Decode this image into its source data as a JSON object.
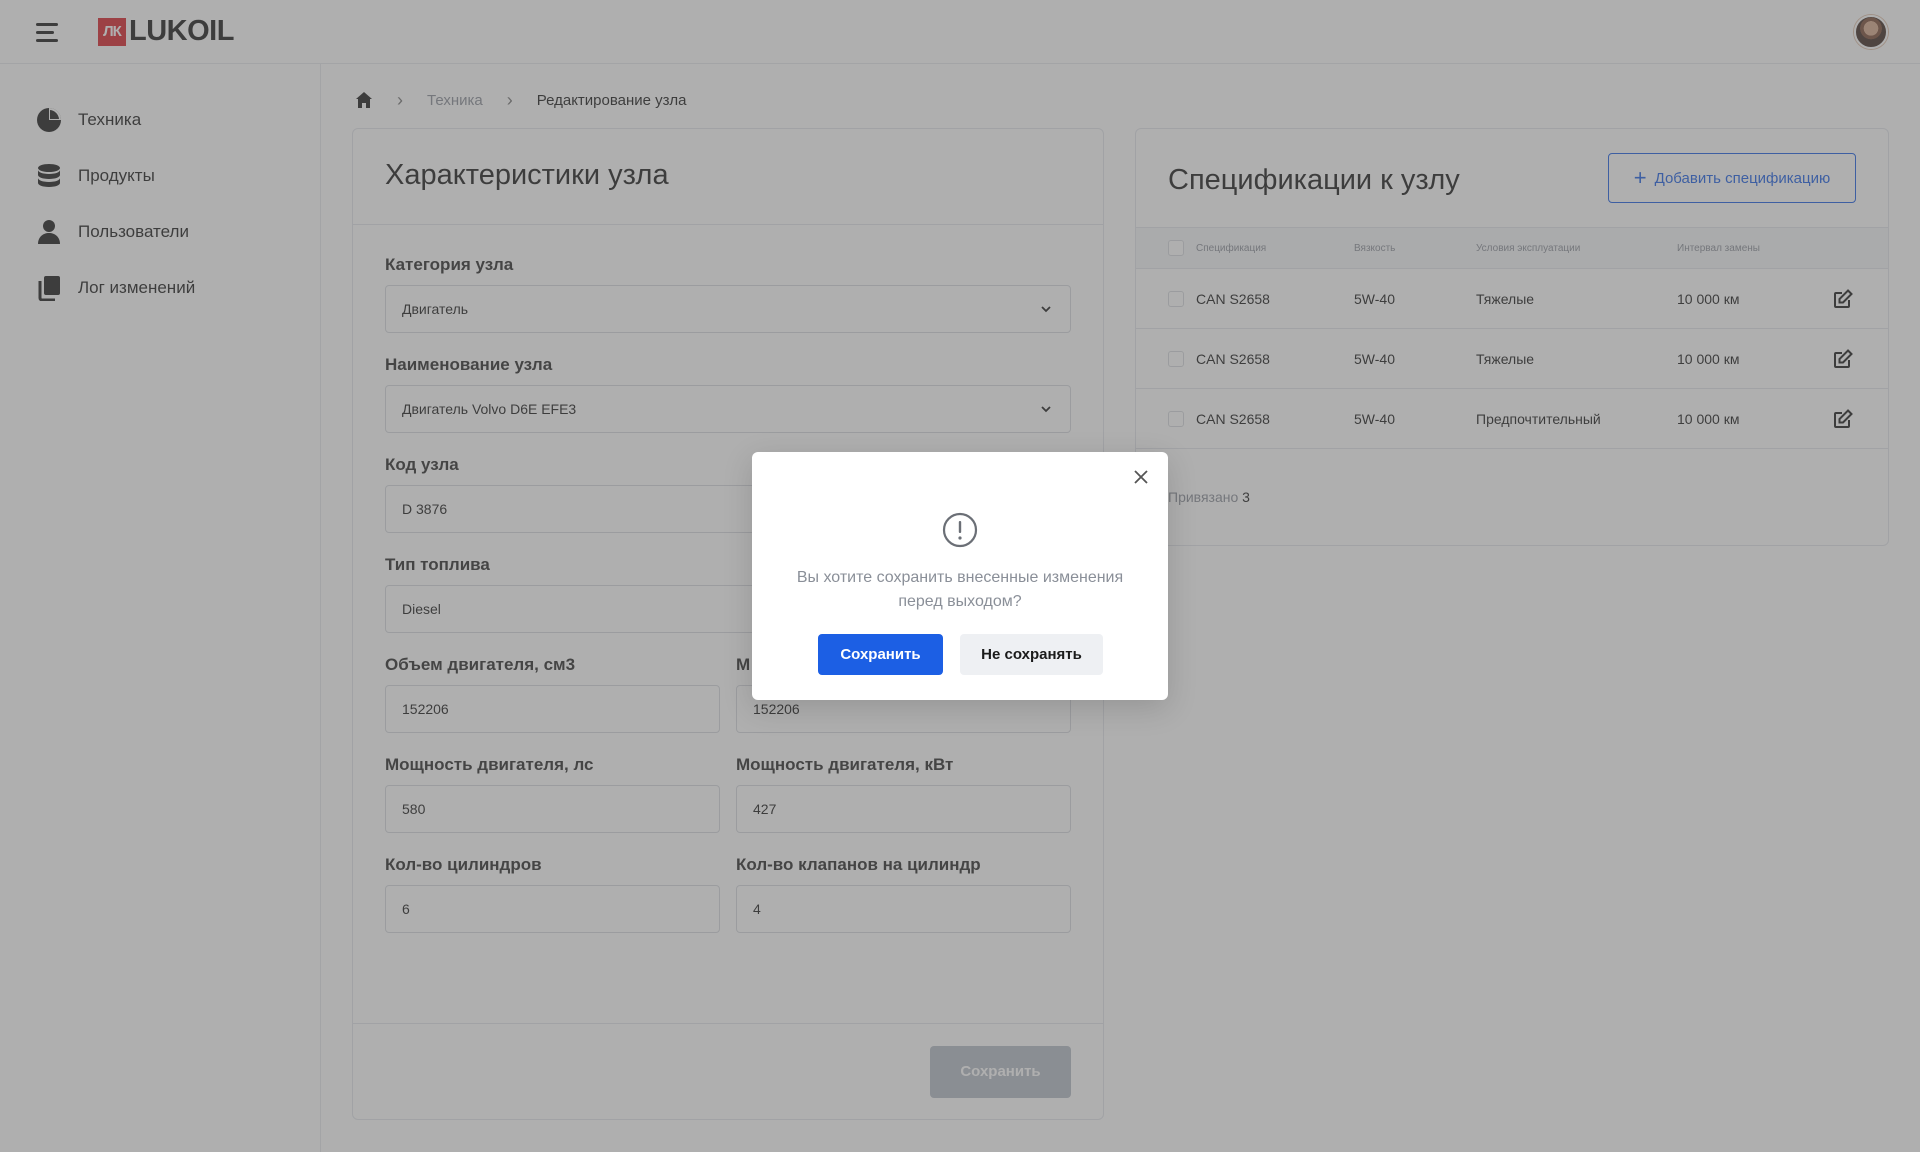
{
  "header": {
    "logo_mark": "ЛК",
    "logo_text": "LUKOIL",
    "menu_icon": "hamburger-icon",
    "avatar": "user-avatar"
  },
  "sidebar": {
    "items": [
      {
        "label": "Техника",
        "icon": "pie-chart-icon"
      },
      {
        "label": "Продукты",
        "icon": "database-icon"
      },
      {
        "label": "Пользователи",
        "icon": "user-icon"
      },
      {
        "label": "Лог изменений",
        "icon": "copy-docs-icon"
      }
    ]
  },
  "breadcrumb": {
    "home_icon": "home-icon",
    "items": [
      "Техника",
      "Редактирование узла"
    ]
  },
  "form": {
    "title": "Характеристики узла",
    "fields": {
      "category": {
        "label": "Категория узла",
        "value": "Двигатель"
      },
      "name": {
        "label": "Наименование узла",
        "value": "Двигатель Volvo D6E EFE3"
      },
      "code": {
        "label": "Код узла",
        "value": "D 3876"
      },
      "fuel": {
        "label": "Тип топлива",
        "value": "Diesel"
      },
      "volume": {
        "label": "Объем двигателя, см3",
        "value": "152206"
      },
      "hidden_second": {
        "label": "М",
        "value": "152206"
      },
      "power_hp": {
        "label": "Мощность двигателя, лс",
        "value": "580"
      },
      "power_kw": {
        "label": "Мощность двигателя, кВт",
        "value": "427"
      },
      "cylinders": {
        "label": "Кол-во цилиндров",
        "value": "6"
      },
      "valves": {
        "label": "Кол-во клапанов на цилиндр",
        "value": "4"
      }
    },
    "save_label": "Сохранить"
  },
  "specs": {
    "title": "Спецификации к узлу",
    "add_label": "Добавить спецификацию",
    "columns": [
      "Спецификация",
      "Вязкость",
      "Условия эксплуатации",
      "Интервал замены"
    ],
    "rows": [
      {
        "spec": "CAN S2658",
        "viscosity": "5W-40",
        "conditions": "Тяжелые",
        "interval": "10 000 км"
      },
      {
        "spec": "CAN S2658",
        "viscosity": "5W-40",
        "conditions": "Тяжелые",
        "interval": "10 000 км"
      },
      {
        "spec": "CAN S2658",
        "viscosity": "5W-40",
        "conditions": "Предпочтительный",
        "interval": "10 000 км"
      }
    ],
    "linked_label": "Привязано",
    "linked_count": "3"
  },
  "modal": {
    "message": "Вы хотите сохранить внесенные изменения перед выходом?",
    "save_label": "Сохранить",
    "dont_save_label": "Не сохранять"
  },
  "colors": {
    "primary": "#1c5fe4",
    "brand_red": "#d8232a",
    "overlay": "rgba(95,95,95,0.5)"
  }
}
